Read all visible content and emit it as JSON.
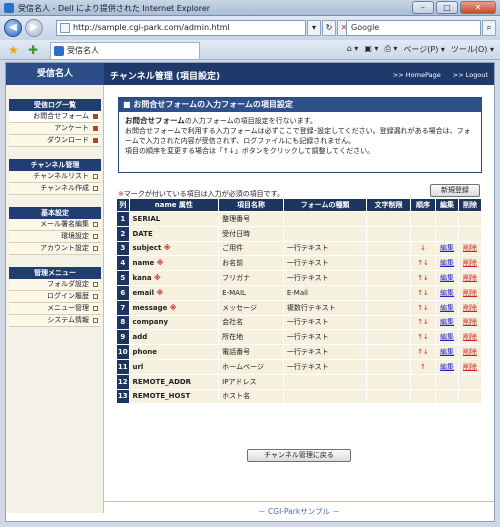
{
  "window": {
    "title": "受信名人 - Dell により提供された Internet Explorer"
  },
  "address": {
    "url": "http://sample.cgi-park.com/admin.html",
    "search_placeholder": "Google"
  },
  "tabbar": {
    "tab_label": "受信名人",
    "page_menu": "ページ(P) ▾",
    "tools_menu": "ツール(O) ▾"
  },
  "site": {
    "name": "受信名人",
    "page_title": "チャンネル管理 (項目設定)",
    "home_link": ">> HomePage",
    "logout_link": ">> Logout"
  },
  "sidebar": {
    "sections": [
      {
        "title": "受信ログ一覧",
        "items": [
          "お問合せフォーム",
          "アンケート",
          "ダウンロード"
        ]
      },
      {
        "title": "チャンネル管理",
        "items": [
          "チャンネルリスト",
          "チャンネル作成"
        ]
      },
      {
        "title": "基本設定",
        "items": [
          "メール署名編集",
          "環境設定",
          "アカウント設定"
        ]
      },
      {
        "title": "管理メニュー",
        "items": [
          "フォルダ設定",
          "ログイン履歴",
          "メニュー管理",
          "システム情報"
        ]
      }
    ]
  },
  "notice": {
    "heading": "■ お問合せフォームの入力フォームの項目設定",
    "bold": "お問合せフォーム",
    "text1": "の入力フォームの項目設定を行ないます。",
    "text2": "お問合せフォームで利用する入力フォームは必ずここで登録･設定してください。登録漏れがある場合は、フォームで入力された内容が受信されず、ログファイルにも記録されません。",
    "text3": "項目の順序を変更する場合は「↑↓」ボタンをクリックして調整してください。"
  },
  "required_note": {
    "mark": "※",
    "text": "マークが付いている項目は入力が必須の項目です。"
  },
  "buttons": {
    "new": "新規登録",
    "back": "チャンネル管理に戻る"
  },
  "table": {
    "headers": [
      "列",
      "name 属性",
      "項目名称",
      "フォームの種類",
      "文字制限",
      "順序",
      "編集",
      "削除"
    ],
    "rows": [
      {
        "n": "1",
        "name": "SERIAL",
        "req": "",
        "label": "整理番号",
        "type": "",
        "limit": "",
        "order": "",
        "edit": "",
        "del": ""
      },
      {
        "n": "2",
        "name": "DATE",
        "req": "",
        "label": "受付日時",
        "type": "",
        "limit": "",
        "order": "",
        "edit": "",
        "del": ""
      },
      {
        "n": "3",
        "name": "subject",
        "req": "※",
        "label": "ご用件",
        "type": "一行テキスト",
        "limit": "",
        "order": "↓",
        "edit": "編集",
        "del": "削除"
      },
      {
        "n": "4",
        "name": "name",
        "req": "※",
        "label": "お名前",
        "type": "一行テキスト",
        "limit": "",
        "order": "↑↓",
        "edit": "編集",
        "del": "削除"
      },
      {
        "n": "5",
        "name": "kana",
        "req": "※",
        "label": "フリガナ",
        "type": "一行テキスト",
        "limit": "",
        "order": "↑↓",
        "edit": "編集",
        "del": "削除"
      },
      {
        "n": "6",
        "name": "email",
        "req": "※",
        "label": "E-MAIL",
        "type": "E-Mail",
        "limit": "",
        "order": "↑↓",
        "edit": "編集",
        "del": "削除"
      },
      {
        "n": "7",
        "name": "message",
        "req": "※",
        "label": "メッセージ",
        "type": "複数行テキスト",
        "limit": "",
        "order": "↑↓",
        "edit": "編集",
        "del": "削除"
      },
      {
        "n": "8",
        "name": "company",
        "req": "",
        "label": "会社名",
        "type": "一行テキスト",
        "limit": "",
        "order": "↑↓",
        "edit": "編集",
        "del": "削除"
      },
      {
        "n": "9",
        "name": "add",
        "req": "",
        "label": "所在地",
        "type": "一行テキスト",
        "limit": "",
        "order": "↑↓",
        "edit": "編集",
        "del": "削除"
      },
      {
        "n": "10",
        "name": "phone",
        "req": "",
        "label": "電話番号",
        "type": "一行テキスト",
        "limit": "",
        "order": "↑↓",
        "edit": "編集",
        "del": "削除"
      },
      {
        "n": "11",
        "name": "url",
        "req": "",
        "label": "ホームページ",
        "type": "一行テキスト",
        "limit": "",
        "order": "↑",
        "edit": "編集",
        "del": "削除"
      },
      {
        "n": "12",
        "name": "REMOTE_ADDR",
        "req": "",
        "label": "IPアドレス",
        "type": "",
        "limit": "",
        "order": "",
        "edit": "",
        "del": ""
      },
      {
        "n": "13",
        "name": "REMOTE_HOST",
        "req": "",
        "label": "ホスト名",
        "type": "",
        "limit": "",
        "order": "",
        "edit": "",
        "del": ""
      }
    ]
  },
  "footer": {
    "text": "－ CGI-Parkサンプル －"
  },
  "colors": {
    "header_navy": "#1f3a6a",
    "row_bg": "#f6f1de",
    "required_red": "#cc2222"
  }
}
